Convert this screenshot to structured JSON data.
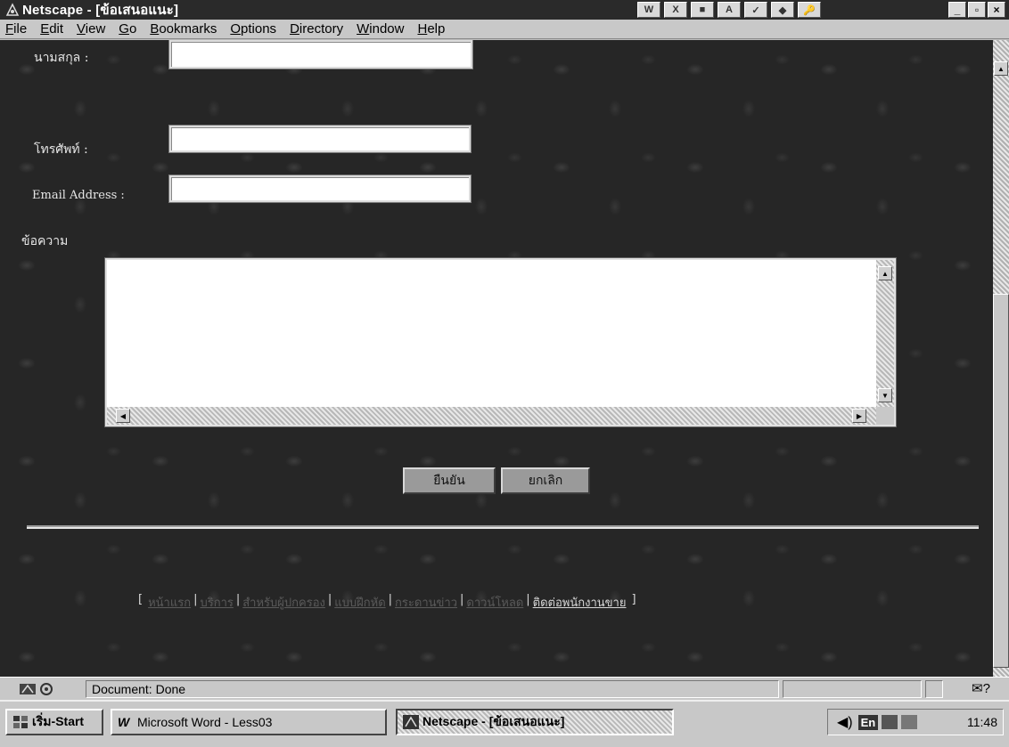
{
  "window": {
    "title": "Netscape - [ข้อเสนอแนะ]",
    "toolbar_icons": [
      "W",
      "X",
      "■",
      "A",
      "✓",
      "◆",
      "🔑"
    ]
  },
  "menu": {
    "items": [
      {
        "u": "F",
        "rest": "ile"
      },
      {
        "u": "E",
        "rest": "dit"
      },
      {
        "u": "V",
        "rest": "iew"
      },
      {
        "u": "G",
        "rest": "o"
      },
      {
        "u": "B",
        "rest": "ookmarks"
      },
      {
        "u": "O",
        "rest": "ptions"
      },
      {
        "u": "D",
        "rest": "irectory"
      },
      {
        "u": "W",
        "rest": "indow"
      },
      {
        "u": "H",
        "rest": "elp"
      }
    ]
  },
  "form": {
    "surname_label": "นามสกุล :",
    "phone_label": "โทรศัพท์ :",
    "email_label": "Email Address :",
    "message_label": "ข้อความ",
    "surname_value": "",
    "phone_value": "",
    "email_value": "",
    "message_value": "",
    "submit_label": "ยืนยัน",
    "cancel_label": "ยกเลิก"
  },
  "footer": {
    "open_bracket": "[",
    "close_bracket": "]",
    "separator": "|",
    "links": [
      "หน้าแรก",
      "บริการ",
      "สำหรับผู้ปกครอง",
      "แบบฝึกหัด",
      "กระดานข่าว",
      "ดาวน์โหลด"
    ],
    "contact_link": "ติดต่อพนักงานขาย"
  },
  "status": {
    "text": "Document: Done",
    "mail_icon": "✉?"
  },
  "taskbar": {
    "start_label": "เริ่ม-Start",
    "word_label": "Microsoft Word - Less03",
    "netscape_label": "Netscape - [ข้อเสนอแนะ]",
    "tray_lang": "En",
    "clock": "11:48"
  },
  "colors": {
    "background": "#262626",
    "chrome": "#c8c8c8"
  }
}
